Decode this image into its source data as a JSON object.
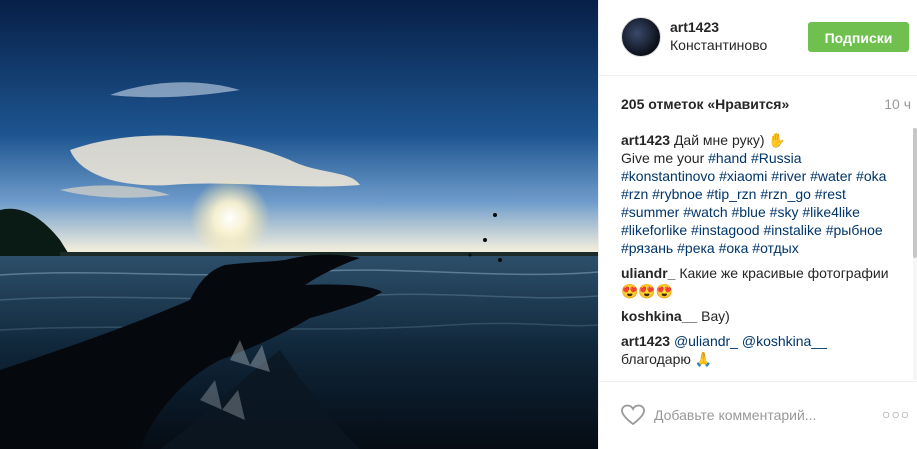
{
  "post": {
    "username": "art1423",
    "location": "Константиново",
    "follow_label": "Подписки",
    "likes": "205 отметок «Нравится»",
    "time": "10 ч"
  },
  "caption": {
    "user": "art1423",
    "line1": "Дай мне руку) ✋",
    "text_prefix": "Give me your",
    "hashtags": [
      "#hand",
      "#Russia",
      "#konstantinovo",
      "#xiaomi",
      "#river",
      "#water",
      "#oka",
      "#rzn",
      "#rybnoe",
      "#tip_rzn",
      "#rzn_go",
      "#rest",
      "#summer",
      "#watch",
      "#blue",
      "#sky",
      "#like4like",
      "#likeforlike",
      "#instagood",
      "#instalike",
      "#рыбное",
      "#рязань",
      "#река",
      "#ока",
      "#отдых"
    ]
  },
  "comments": [
    {
      "user": "uliandr_",
      "text": "Какие же красивые фотографии😍😍😍"
    },
    {
      "user": "koshkina__",
      "text": "Вау)"
    },
    {
      "user": "art1423",
      "mentions": [
        "@uliandr_",
        "@koshkina__"
      ],
      "text": "благодарю 🙏"
    }
  ],
  "footer": {
    "placeholder": "Добавьте комментарий...",
    "more": "○○○"
  },
  "icons": {
    "like": "heart-outline-icon",
    "more": "more-options-icon"
  },
  "colors": {
    "follow_button": "#70c050",
    "hashtag": "#003569",
    "muted": "#999999"
  }
}
